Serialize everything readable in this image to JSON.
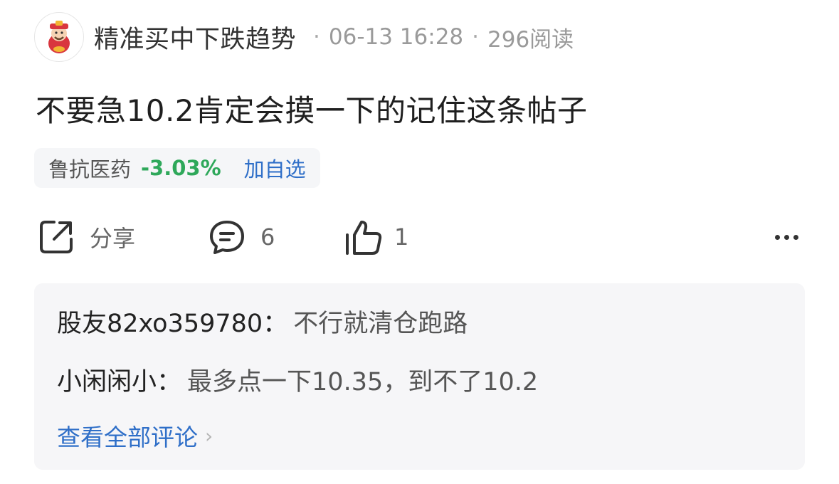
{
  "post": {
    "author": "精准买中下跌趋势",
    "separator": "·",
    "time": "06-13 16:28",
    "views": "296阅读",
    "title": "不要急10.2肯定会摸一下的记住这条帖子"
  },
  "stock": {
    "name": "鲁抗医药",
    "change": "-3.03%",
    "add_label": "加自选",
    "change_color": "#2ea85a"
  },
  "actions": {
    "share_label": "分享",
    "comment_count": "6",
    "like_count": "1",
    "icons": [
      "share-icon",
      "comment-icon",
      "like-icon",
      "more-icon"
    ]
  },
  "comments": [
    {
      "user": "股友82xo359780",
      "sep": "：",
      "text": "不行就清仓跑路"
    },
    {
      "user": "小闲闲小",
      "sep": "：",
      "text": "最多点一下10.35，到不了10.2"
    }
  ],
  "view_all_label": "查看全部评论",
  "view_all_chevron": "›"
}
